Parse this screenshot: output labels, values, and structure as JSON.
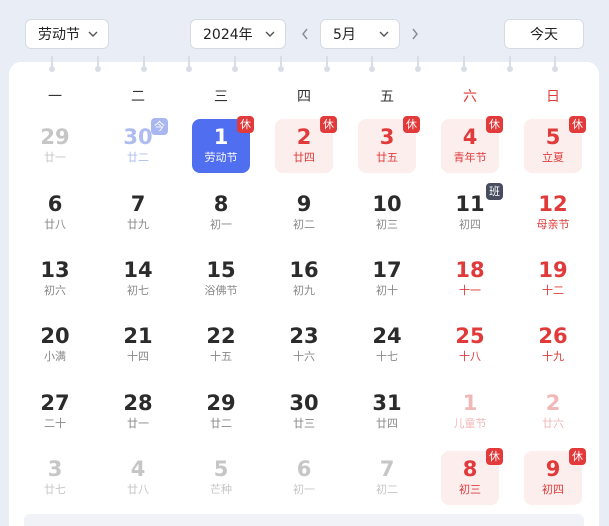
{
  "toolbar": {
    "holiday_select": "劳动节",
    "year_select": "2024年",
    "month_select": "5月",
    "today_label": "今天"
  },
  "colors": {
    "accent": "#4f6ef0",
    "holiday_red": "#e03a3a",
    "holiday_bg": "#fdeeee",
    "work_badge": "#474d5e"
  },
  "icons": {
    "dropdown": "chevron-down-icon",
    "prev": "chevron-left-icon",
    "next": "chevron-right-icon"
  },
  "weekdays": [
    "一",
    "二",
    "三",
    "四",
    "五",
    "六",
    "日"
  ],
  "weeks": [
    [
      {
        "day": "29",
        "sub": "廿一",
        "state": "dim"
      },
      {
        "day": "30",
        "sub": "廿二",
        "state": "today",
        "badge": "今",
        "badge_type": "today-tag"
      },
      {
        "day": "1",
        "sub": "劳动节",
        "state": "selected",
        "badge": "休",
        "badge_type": "rest"
      },
      {
        "day": "2",
        "sub": "廿四",
        "state": "holiday",
        "badge": "休",
        "badge_type": "rest"
      },
      {
        "day": "3",
        "sub": "廿五",
        "state": "holiday",
        "badge": "休",
        "badge_type": "rest"
      },
      {
        "day": "4",
        "sub": "青年节",
        "state": "holiday",
        "badge": "休",
        "badge_type": "rest"
      },
      {
        "day": "5",
        "sub": "立夏",
        "state": "holiday",
        "badge": "休",
        "badge_type": "rest"
      }
    ],
    [
      {
        "day": "6",
        "sub": "廿八",
        "state": "normal"
      },
      {
        "day": "7",
        "sub": "廿九",
        "state": "normal"
      },
      {
        "day": "8",
        "sub": "初一",
        "state": "normal"
      },
      {
        "day": "9",
        "sub": "初二",
        "state": "normal"
      },
      {
        "day": "10",
        "sub": "初三",
        "state": "normal"
      },
      {
        "day": "11",
        "sub": "初四",
        "state": "workday",
        "badge": "班",
        "badge_type": "work"
      },
      {
        "day": "12",
        "sub": "母亲节",
        "state": "weekend"
      }
    ],
    [
      {
        "day": "13",
        "sub": "初六",
        "state": "normal"
      },
      {
        "day": "14",
        "sub": "初七",
        "state": "normal"
      },
      {
        "day": "15",
        "sub": "浴佛节",
        "state": "normal"
      },
      {
        "day": "16",
        "sub": "初九",
        "state": "normal"
      },
      {
        "day": "17",
        "sub": "初十",
        "state": "normal"
      },
      {
        "day": "18",
        "sub": "十一",
        "state": "weekend"
      },
      {
        "day": "19",
        "sub": "十二",
        "state": "weekend"
      }
    ],
    [
      {
        "day": "20",
        "sub": "小满",
        "state": "normal"
      },
      {
        "day": "21",
        "sub": "十四",
        "state": "normal"
      },
      {
        "day": "22",
        "sub": "十五",
        "state": "normal"
      },
      {
        "day": "23",
        "sub": "十六",
        "state": "normal"
      },
      {
        "day": "24",
        "sub": "十七",
        "state": "normal"
      },
      {
        "day": "25",
        "sub": "十八",
        "state": "weekend"
      },
      {
        "day": "26",
        "sub": "十九",
        "state": "weekend"
      }
    ],
    [
      {
        "day": "27",
        "sub": "二十",
        "state": "normal"
      },
      {
        "day": "28",
        "sub": "廿一",
        "state": "normal"
      },
      {
        "day": "29",
        "sub": "廿二",
        "state": "normal"
      },
      {
        "day": "30",
        "sub": "廿三",
        "state": "normal"
      },
      {
        "day": "31",
        "sub": "廿四",
        "state": "normal"
      },
      {
        "day": "1",
        "sub": "儿童节",
        "state": "dim-weekend"
      },
      {
        "day": "2",
        "sub": "廿六",
        "state": "dim-weekend"
      }
    ],
    [
      {
        "day": "3",
        "sub": "廿七",
        "state": "dim"
      },
      {
        "day": "4",
        "sub": "廿八",
        "state": "dim"
      },
      {
        "day": "5",
        "sub": "芒种",
        "state": "dim"
      },
      {
        "day": "6",
        "sub": "初一",
        "state": "dim"
      },
      {
        "day": "7",
        "sub": "初二",
        "state": "dim"
      },
      {
        "day": "8",
        "sub": "初三",
        "state": "holiday",
        "badge": "休",
        "badge_type": "rest"
      },
      {
        "day": "9",
        "sub": "初四",
        "state": "holiday",
        "badge": "休",
        "badge_type": "rest"
      }
    ]
  ]
}
